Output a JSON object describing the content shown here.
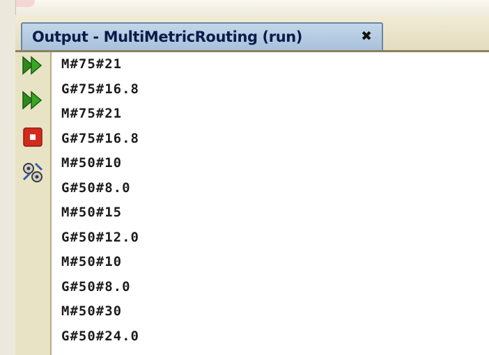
{
  "output_panel": {
    "tab_title": "Output - MultiMetricRouting (run)",
    "close_glyph": "✖"
  },
  "toolbar": {
    "buttons": [
      {
        "name": "rerun-icon",
        "color": "#2f8a1e"
      },
      {
        "name": "rerun-different-params-icon",
        "color": "#2f8a1e"
      },
      {
        "name": "stop-icon",
        "color": "#d42a1e"
      },
      {
        "name": "settings-icon",
        "color": "#3a3a3a"
      }
    ]
  },
  "console": {
    "lines": [
      "M#75#21",
      "G#75#16.8",
      "M#75#21",
      "G#75#16.8",
      "M#50#10",
      "G#50#8.0",
      "M#50#15",
      "G#50#12.0",
      "M#50#10",
      "G#50#8.0",
      "M#50#30",
      "G#50#24.0"
    ]
  }
}
